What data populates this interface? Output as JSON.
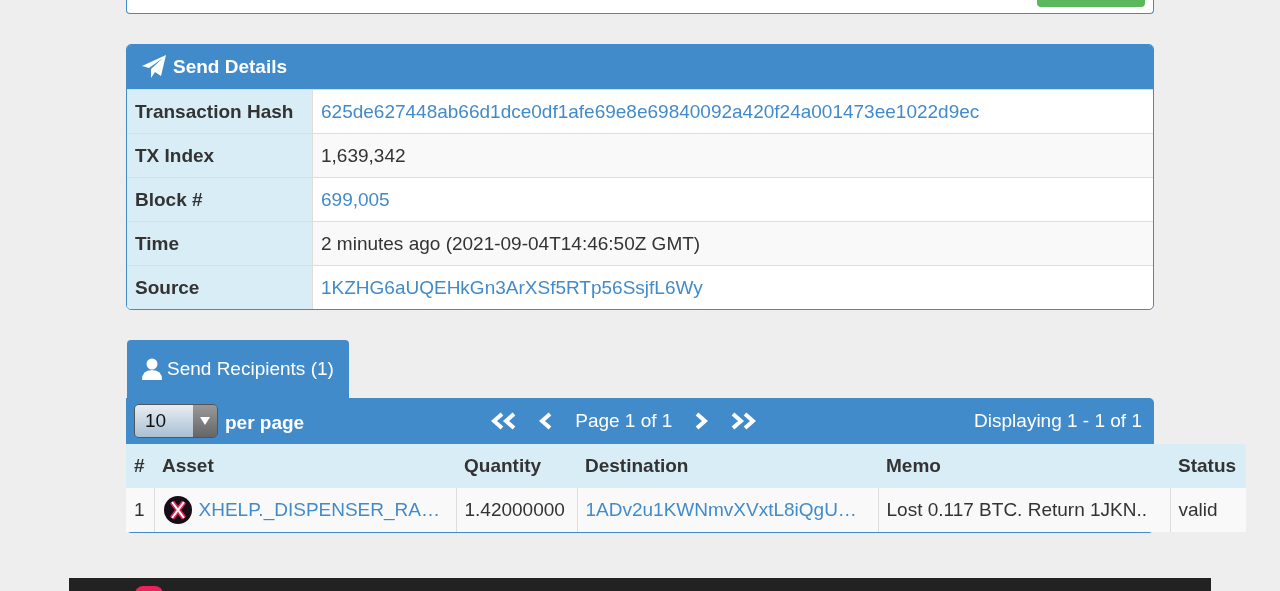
{
  "send_details": {
    "title": "Send Details",
    "rows": [
      {
        "label": "Transaction Hash",
        "value": "625de627448ab66d1dce0df1afe69e8e69840092a420f24a001473ee1022d9ec",
        "link": true
      },
      {
        "label": "TX Index",
        "value": "1,639,342",
        "link": false
      },
      {
        "label": "Block #",
        "value": "699,005",
        "link": true
      },
      {
        "label": "Time",
        "value": "2 minutes ago (2021-09-04T14:46:50Z GMT)",
        "link": false
      },
      {
        "label": "Source",
        "value": "1KZHG6aUQEHkGn3ArXSf5RTp56SsjfL6Wy",
        "link": true
      }
    ]
  },
  "recipients": {
    "tabs": [
      {
        "label": "Send Recipients (1)",
        "selected": true
      }
    ],
    "per_page": {
      "value": "10",
      "label": "per page"
    },
    "page_text": "Page 1 of 1",
    "displaying": "Displaying 1 - 1 of 1",
    "columns": [
      "#",
      "Asset",
      "Quantity",
      "Destination",
      "Memo",
      "Status"
    ],
    "rows": [
      {
        "index": "1",
        "asset": "XHELP._DISPENSER_RA…",
        "quantity": "1.42000000",
        "destination": "1ADv2u1KWNmvXVxtL8iQgU…",
        "memo": "Lost 0.117 BTC. Return 1JKN..",
        "status": "valid"
      }
    ]
  }
}
